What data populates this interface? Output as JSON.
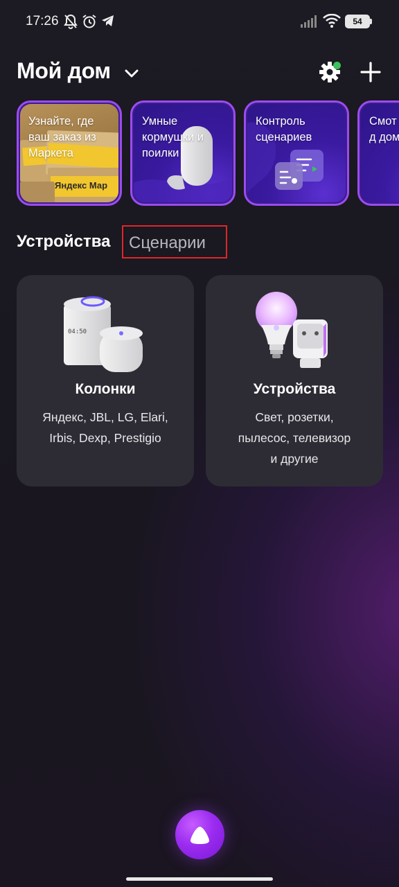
{
  "status_bar": {
    "time": "17:26",
    "battery": "54",
    "icons": [
      "bell-off-icon",
      "alarm-icon",
      "telegram-icon",
      "signal-icon",
      "wifi-icon",
      "battery-icon"
    ]
  },
  "header": {
    "title": "Мой дом",
    "settings_badge_color": "#3ec05a"
  },
  "stories": [
    {
      "text": "Узнайте, где ваш заказ из Маркета",
      "tape_text": "Яндекс Мар"
    },
    {
      "text": "Умные кормушки и поилки"
    },
    {
      "text": "Контроль сценариев"
    },
    {
      "text": "Смот как д дома"
    }
  ],
  "tabs": {
    "devices": "Устройства",
    "scenarios": "Сценарии"
  },
  "cards": [
    {
      "title": "Колонки",
      "desc": [
        "Яндекс, JBL, LG, Elari,",
        "Irbis, Dexp, Prestigio"
      ],
      "screen_text": "04:50"
    },
    {
      "title": "Устройства",
      "desc": [
        "Свет, розетки,",
        "пылесос, телевизор",
        "и другие"
      ]
    }
  ],
  "colors": {
    "accent": "#9b4cf0",
    "highlight_box": "#e0262a",
    "card_bg": "#2d2c34"
  }
}
